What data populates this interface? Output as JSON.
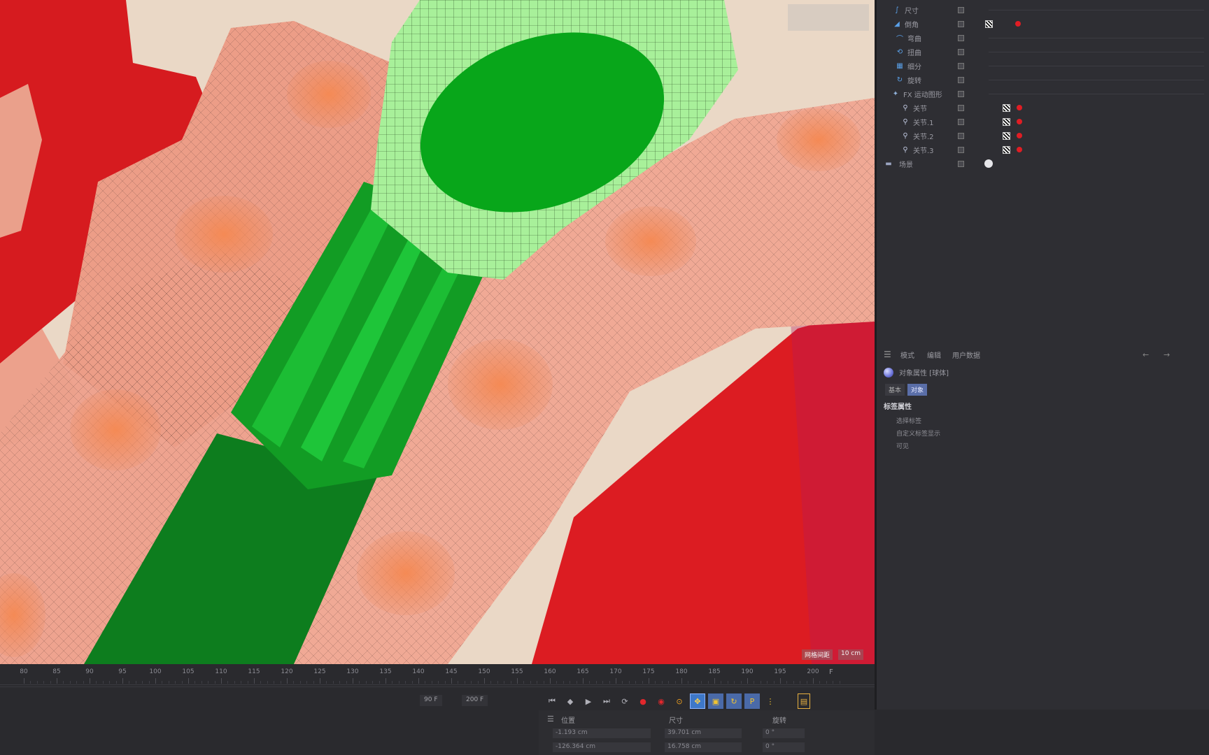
{
  "object_manager": {
    "rows": [
      {
        "name": "尺寸",
        "icon": "bend-deformer-icon"
      },
      {
        "name": "倒角",
        "icon": "bevel-icon"
      },
      {
        "name": "弯曲",
        "icon": "bend-icon"
      },
      {
        "name": "扭曲",
        "icon": "twist-icon"
      },
      {
        "name": "细分",
        "icon": "subdivide-icon"
      },
      {
        "name": "旋转",
        "icon": "rotate-icon"
      },
      {
        "name": "FX 运动图形",
        "icon": "mograph-icon"
      },
      {
        "name": "关节",
        "icon": "joint-icon"
      },
      {
        "name": "关节.1",
        "icon": "joint-icon"
      },
      {
        "name": "关节.2",
        "icon": "joint-icon"
      },
      {
        "name": "关节.3",
        "icon": "joint-icon"
      },
      {
        "name": "场景",
        "icon": "scene-icon"
      }
    ]
  },
  "attributes": {
    "menu": [
      "模式",
      "编辑",
      "用户数据"
    ],
    "object_title": "对象属性 [球体]",
    "tabs": [
      "基本",
      "对象"
    ],
    "section": "标签属性",
    "fields": [
      "选择标签",
      "自定义标签显示",
      "可见"
    ]
  },
  "viewport": {
    "hud_bottom": [
      "网格间距",
      "10 cm"
    ]
  },
  "timeline": {
    "ticks": [
      "80",
      "85",
      "90",
      "95",
      "100",
      "105",
      "110",
      "115",
      "120",
      "125",
      "130",
      "135",
      "140",
      "145",
      "150",
      "155",
      "160",
      "165",
      "170",
      "175",
      "180",
      "185",
      "190",
      "195",
      "200"
    ],
    "end_label": "F",
    "frame_start": "90 F",
    "frame_end": "200 F"
  },
  "coordinates": {
    "headers": [
      "位置",
      "尺寸",
      "旋转"
    ],
    "values": [
      "-1.193 cm",
      "39.701 cm",
      "0 °",
      "-126.364 cm",
      "16.758 cm",
      "0 °"
    ]
  }
}
